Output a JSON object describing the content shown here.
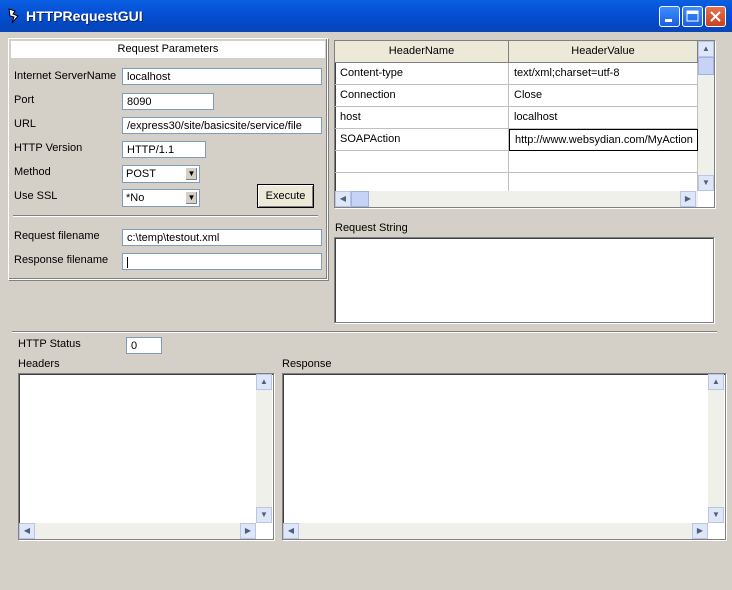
{
  "window": {
    "title": "HTTPRequestGUI"
  },
  "request_params": {
    "heading": "Request Parameters",
    "server_label": "Internet ServerName",
    "server_value": "localhost",
    "port_label": "Port",
    "port_value": "8090",
    "url_label": "URL",
    "url_value": "/express30/site/basicsite/service/file",
    "version_label": "HTTP Version",
    "version_value": "HTTP/1.1",
    "method_label": "Method",
    "method_value": "POST",
    "ssl_label": "Use SSL",
    "ssl_value": "*No",
    "execute_label": "Execute",
    "req_file_label": "Request filename",
    "req_file_value": "c:\\temp\\testout.xml",
    "resp_file_label": "Response filename",
    "resp_file_value": ""
  },
  "headers_grid": {
    "col_name": "HeaderName",
    "col_value": "HeaderValue",
    "rows": [
      {
        "name": "Content-type",
        "value": "text/xml;charset=utf-8"
      },
      {
        "name": "Connection",
        "value": "Close"
      },
      {
        "name": "host",
        "value": "localhost"
      },
      {
        "name": "SOAPAction",
        "value": "http://www.websydian.com/MyAction"
      },
      {
        "name": "",
        "value": ""
      },
      {
        "name": "",
        "value": ""
      }
    ]
  },
  "request_string": {
    "label": "Request String",
    "value": ""
  },
  "status": {
    "label": "HTTP Status",
    "value": "0"
  },
  "headers_panel": {
    "label": "Headers",
    "value": ""
  },
  "response_panel": {
    "label": "Response",
    "value": ""
  },
  "colors": {
    "title_bar": "#0550d5",
    "window_bg": "#d4d0c8"
  },
  "icons": [
    "app-icon",
    "minimize-icon",
    "maximize-icon",
    "close-icon"
  ]
}
